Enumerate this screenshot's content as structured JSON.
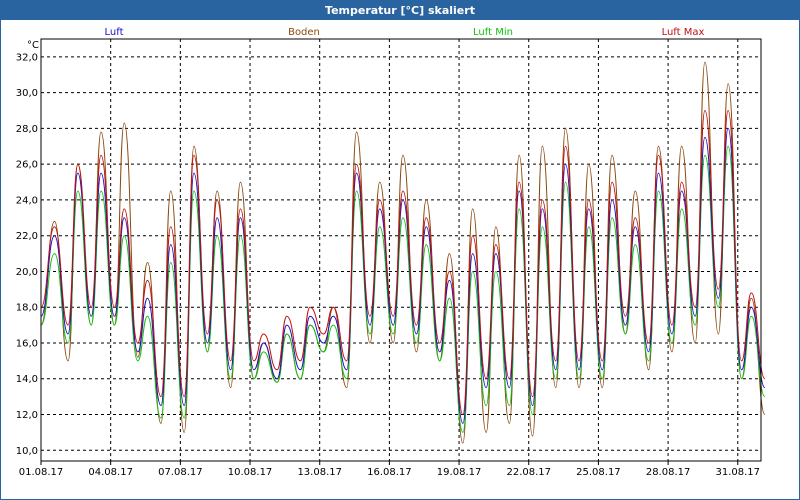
{
  "window": {
    "title": "Temperatur [°C] skaliert"
  },
  "colors": {
    "Luft": "#1a10c8",
    "Boden": "#8a4a10",
    "Luft Min": "#10c010",
    "Luft Max": "#c01010",
    "grid": "#000000"
  },
  "chart_data": {
    "type": "line",
    "title": "Temperatur [°C] skaliert",
    "ylabel": "°C",
    "xlabel": "",
    "ylim": [
      9.4,
      33.0
    ],
    "xlim_days": [
      "01.08.17",
      "01.09.17"
    ],
    "grid": true,
    "legend_position": "top",
    "y_ticks": [
      "10,0",
      "12,0",
      "14,0",
      "16,0",
      "18,0",
      "20,0",
      "22,0",
      "24,0",
      "26,0",
      "28,0",
      "30,0",
      "32,0"
    ],
    "x_ticks": [
      "01.08.17",
      "04.08.17",
      "07.08.17",
      "10.08.17",
      "13.08.17",
      "16.08.17",
      "19.08.17",
      "22.08.17",
      "25.08.17",
      "28.08.17",
      "31.08.17"
    ],
    "series": [
      {
        "name": "Luft",
        "x": [
          "01.08.17 00:00",
          "01.08.17 14:00",
          "02.08.17 04:00",
          "02.08.17 14:00",
          "03.08.17 04:00",
          "03.08.17 14:00",
          "04.08.17 04:00",
          "04.08.17 14:00",
          "05.08.17 04:00",
          "05.08.17 14:00",
          "06.08.17 04:00",
          "06.08.17 14:00",
          "07.08.17 04:00",
          "07.08.17 14:00",
          "08.08.17 04:00",
          "08.08.17 14:00",
          "09.08.17 04:00",
          "09.08.17 14:00",
          "10.08.17 04:00",
          "10.08.17 14:00",
          "11.08.17 04:00",
          "11.08.17 14:00",
          "12.08.17 04:00",
          "12.08.17 14:00",
          "13.08.17 04:00",
          "13.08.17 14:00",
          "14.08.17 04:00",
          "14.08.17 14:00",
          "15.08.17 04:00",
          "15.08.17 14:00",
          "16.08.17 04:00",
          "16.08.17 14:00",
          "17.08.17 04:00",
          "17.08.17 14:00",
          "18.08.17 04:00",
          "18.08.17 14:00",
          "19.08.17 04:00",
          "19.08.17 14:00",
          "20.08.17 04:00",
          "20.08.17 14:00",
          "21.08.17 04:00",
          "21.08.17 14:00",
          "22.08.17 04:00",
          "22.08.17 14:00",
          "23.08.17 04:00",
          "23.08.17 14:00",
          "24.08.17 04:00",
          "24.08.17 14:00",
          "25.08.17 04:00",
          "25.08.17 14:00",
          "26.08.17 04:00",
          "26.08.17 14:00",
          "27.08.17 04:00",
          "27.08.17 14:00",
          "28.08.17 04:00",
          "28.08.17 14:00",
          "29.08.17 04:00",
          "29.08.17 14:00",
          "30.08.17 04:00",
          "30.08.17 14:00",
          "31.08.17 04:00",
          "31.08.17 14:00",
          "01.09.17 04:00"
        ],
        "values": [
          17.5,
          22.0,
          16.5,
          25.5,
          17.5,
          25.5,
          17.5,
          23.0,
          15.5,
          18.5,
          12.5,
          21.5,
          12.5,
          25.5,
          16.0,
          23.0,
          14.5,
          23.0,
          14.5,
          16.0,
          14.0,
          17.0,
          14.5,
          17.5,
          16.0,
          17.5,
          14.5,
          25.5,
          17.0,
          23.5,
          17.0,
          24.0,
          16.5,
          22.5,
          15.5,
          19.5,
          11.5,
          21.0,
          13.5,
          21.0,
          13.5,
          24.5,
          12.5,
          23.5,
          14.5,
          26.0,
          14.5,
          23.5,
          14.5,
          24.0,
          17.0,
          22.5,
          15.5,
          25.5,
          16.5,
          24.5,
          17.5,
          27.5,
          18.5,
          28.0,
          14.5,
          18.0,
          13.5
        ]
      },
      {
        "name": "Boden",
        "x": [
          "01.08.17 00:00",
          "01.08.17 14:00",
          "02.08.17 04:00",
          "02.08.17 14:00",
          "03.08.17 04:00",
          "03.08.17 14:00",
          "04.08.17 04:00",
          "04.08.17 14:00",
          "05.08.17 04:00",
          "05.08.17 14:00",
          "06.08.17 04:00",
          "06.08.17 14:00",
          "07.08.17 04:00",
          "07.08.17 14:00",
          "08.08.17 04:00",
          "08.08.17 14:00",
          "09.08.17 04:00",
          "09.08.17 14:00",
          "10.08.17 04:00",
          "10.08.17 14:00",
          "11.08.17 04:00",
          "11.08.17 14:00",
          "12.08.17 04:00",
          "12.08.17 14:00",
          "13.08.17 04:00",
          "13.08.17 14:00",
          "14.08.17 04:00",
          "14.08.17 14:00",
          "15.08.17 04:00",
          "15.08.17 14:00",
          "16.08.17 04:00",
          "16.08.17 14:00",
          "17.08.17 04:00",
          "17.08.17 14:00",
          "18.08.17 04:00",
          "18.08.17 14:00",
          "19.08.17 04:00",
          "19.08.17 14:00",
          "20.08.17 04:00",
          "20.08.17 14:00",
          "21.08.17 04:00",
          "21.08.17 14:00",
          "22.08.17 04:00",
          "22.08.17 14:00",
          "23.08.17 04:00",
          "23.08.17 14:00",
          "24.08.17 04:00",
          "24.08.17 14:00",
          "25.08.17 04:00",
          "25.08.17 14:00",
          "26.08.17 04:00",
          "26.08.17 14:00",
          "27.08.17 04:00",
          "27.08.17 14:00",
          "28.08.17 04:00",
          "28.08.17 14:00",
          "29.08.17 04:00",
          "29.08.17 14:00",
          "30.08.17 04:00",
          "30.08.17 14:00",
          "31.08.17 04:00",
          "31.08.17 14:00",
          "01.09.17 04:00"
        ],
        "values": [
          17.0,
          22.8,
          15.0,
          26.0,
          17.0,
          27.8,
          17.0,
          28.3,
          15.2,
          20.5,
          11.5,
          24.5,
          11.0,
          27.0,
          15.5,
          24.5,
          13.5,
          25.0,
          14.0,
          16.0,
          13.8,
          16.5,
          14.0,
          17.0,
          15.5,
          18.0,
          13.5,
          27.8,
          16.0,
          25.0,
          16.0,
          26.5,
          15.5,
          24.0,
          15.0,
          21.0,
          10.4,
          23.5,
          11.0,
          22.5,
          11.5,
          26.5,
          10.8,
          27.0,
          13.5,
          28.0,
          13.5,
          26.0,
          13.5,
          26.5,
          16.5,
          24.5,
          14.5,
          27.0,
          15.5,
          27.0,
          16.0,
          31.7,
          16.5,
          30.5,
          14.0,
          18.5,
          12.0
        ]
      },
      {
        "name": "Luft Min",
        "x": [
          "01.08.17 00:00",
          "01.08.17 14:00",
          "02.08.17 04:00",
          "02.08.17 14:00",
          "03.08.17 04:00",
          "03.08.17 14:00",
          "04.08.17 04:00",
          "04.08.17 14:00",
          "05.08.17 04:00",
          "05.08.17 14:00",
          "06.08.17 04:00",
          "06.08.17 14:00",
          "07.08.17 04:00",
          "07.08.17 14:00",
          "08.08.17 04:00",
          "08.08.17 14:00",
          "09.08.17 04:00",
          "09.08.17 14:00",
          "10.08.17 04:00",
          "10.08.17 14:00",
          "11.08.17 04:00",
          "11.08.17 14:00",
          "12.08.17 04:00",
          "12.08.17 14:00",
          "13.08.17 04:00",
          "13.08.17 14:00",
          "14.08.17 04:00",
          "14.08.17 14:00",
          "15.08.17 04:00",
          "15.08.17 14:00",
          "16.08.17 04:00",
          "16.08.17 14:00",
          "17.08.17 04:00",
          "17.08.17 14:00",
          "18.08.17 04:00",
          "18.08.17 14:00",
          "19.08.17 04:00",
          "19.08.17 14:00",
          "20.08.17 04:00",
          "20.08.17 14:00",
          "21.08.17 04:00",
          "21.08.17 14:00",
          "22.08.17 04:00",
          "22.08.17 14:00",
          "23.08.17 04:00",
          "23.08.17 14:00",
          "24.08.17 04:00",
          "24.08.17 14:00",
          "25.08.17 04:00",
          "25.08.17 14:00",
          "26.08.17 04:00",
          "26.08.17 14:00",
          "27.08.17 04:00",
          "27.08.17 14:00",
          "28.08.17 04:00",
          "28.08.17 14:00",
          "29.08.17 04:00",
          "29.08.17 14:00",
          "30.08.17 04:00",
          "30.08.17 14:00",
          "31.08.17 04:00",
          "31.08.17 14:00",
          "01.09.17 04:00"
        ],
        "values": [
          17.0,
          21.0,
          16.0,
          24.5,
          17.0,
          24.5,
          17.0,
          22.0,
          15.0,
          17.5,
          11.8,
          20.5,
          11.8,
          24.5,
          15.5,
          22.0,
          14.0,
          22.0,
          14.0,
          15.5,
          13.8,
          16.5,
          14.0,
          17.0,
          15.5,
          17.0,
          14.0,
          24.5,
          16.5,
          22.5,
          16.5,
          23.0,
          16.0,
          21.5,
          15.0,
          18.5,
          11.0,
          20.0,
          12.5,
          20.0,
          12.5,
          23.5,
          12.0,
          22.5,
          14.0,
          25.0,
          14.0,
          22.5,
          14.0,
          23.0,
          16.5,
          21.5,
          15.0,
          24.5,
          16.0,
          23.5,
          17.0,
          26.5,
          18.0,
          27.0,
          14.0,
          17.5,
          13.0
        ]
      },
      {
        "name": "Luft Max",
        "x": [
          "01.08.17 00:00",
          "01.08.17 14:00",
          "02.08.17 04:00",
          "02.08.17 14:00",
          "03.08.17 04:00",
          "03.08.17 14:00",
          "04.08.17 04:00",
          "04.08.17 14:00",
          "05.08.17 04:00",
          "05.08.17 14:00",
          "06.08.17 04:00",
          "06.08.17 14:00",
          "07.08.17 04:00",
          "07.08.17 14:00",
          "08.08.17 04:00",
          "08.08.17 14:00",
          "09.08.17 04:00",
          "09.08.17 14:00",
          "10.08.17 04:00",
          "10.08.17 14:00",
          "11.08.17 04:00",
          "11.08.17 14:00",
          "12.08.17 04:00",
          "12.08.17 14:00",
          "13.08.17 04:00",
          "13.08.17 14:00",
          "14.08.17 04:00",
          "14.08.17 14:00",
          "15.08.17 04:00",
          "15.08.17 14:00",
          "16.08.17 04:00",
          "16.08.17 14:00",
          "17.08.17 04:00",
          "17.08.17 14:00",
          "18.08.17 04:00",
          "18.08.17 14:00",
          "19.08.17 04:00",
          "19.08.17 14:00",
          "20.08.17 04:00",
          "20.08.17 14:00",
          "21.08.17 04:00",
          "21.08.17 14:00",
          "22.08.17 04:00",
          "22.08.17 14:00",
          "23.08.17 04:00",
          "23.08.17 14:00",
          "24.08.17 04:00",
          "24.08.17 14:00",
          "25.08.17 04:00",
          "25.08.17 14:00",
          "26.08.17 04:00",
          "26.08.17 14:00",
          "27.08.17 04:00",
          "27.08.17 14:00",
          "28.08.17 04:00",
          "28.08.17 14:00",
          "29.08.17 04:00",
          "29.08.17 14:00",
          "30.08.17 04:00",
          "30.08.17 14:00",
          "31.08.17 04:00",
          "31.08.17 14:00",
          "01.09.17 04:00"
        ],
        "values": [
          18.0,
          22.5,
          17.0,
          26.0,
          18.0,
          26.5,
          18.0,
          23.5,
          16.0,
          19.5,
          13.0,
          22.5,
          13.0,
          26.5,
          16.5,
          24.0,
          15.0,
          23.5,
          15.0,
          16.5,
          14.5,
          17.5,
          15.0,
          18.0,
          16.5,
          18.0,
          15.0,
          26.0,
          17.5,
          24.0,
          17.5,
          24.5,
          17.0,
          23.0,
          16.0,
          20.0,
          12.0,
          22.0,
          14.0,
          21.5,
          14.0,
          25.0,
          13.0,
          24.0,
          15.0,
          27.0,
          15.0,
          24.0,
          15.0,
          25.0,
          17.5,
          23.0,
          16.0,
          26.5,
          17.0,
          25.0,
          18.0,
          29.0,
          19.0,
          29.0,
          15.0,
          18.8,
          14.0
        ]
      }
    ]
  }
}
